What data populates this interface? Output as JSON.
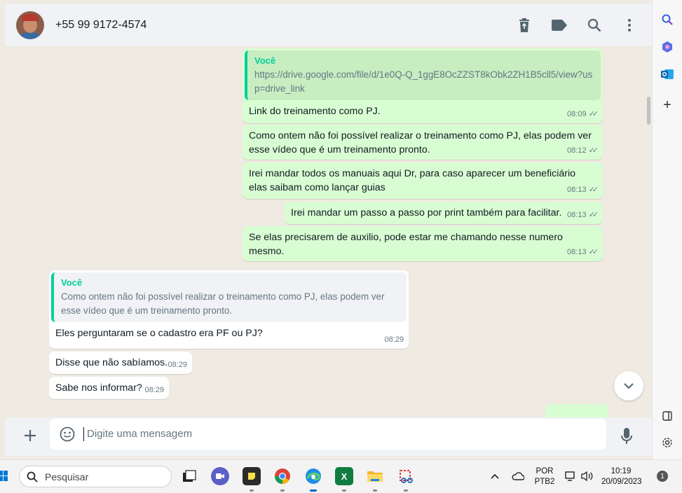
{
  "header": {
    "contact_name": "+55 99 9172-4574",
    "icons": [
      "delete-icon",
      "label-icon",
      "search-icon",
      "more-menu-icon"
    ]
  },
  "messages": [
    {
      "direction": "outgoing",
      "quote_author": "Você",
      "quote_text": "https://drive.google.com/file/d/1e0Q-Q_1ggE8OcZZST8kObk2ZH1B5cll5/view?usp=drive_link",
      "text": "Link do treinamento como PJ.",
      "time": "08:09",
      "status": "read"
    },
    {
      "direction": "outgoing",
      "text": "Como ontem não foi possível realizar o treinamento como PJ, elas podem ver esse vídeo que é um treinamento pronto.",
      "time": "08:12",
      "status": "read"
    },
    {
      "direction": "outgoing",
      "text": "Irei mandar todos os manuais aqui Dr, para caso aparecer um beneficiário elas saibam como lançar guias",
      "time": "08:13",
      "status": "read"
    },
    {
      "direction": "outgoing",
      "text": "Irei mandar um passo a passo por print também para facilitar.",
      "time": "08:13",
      "status": "read"
    },
    {
      "direction": "outgoing",
      "text": "Se elas precisarem de auxilio, pode estar me chamando nesse numero mesmo.",
      "time": "08:13",
      "status": "read"
    },
    {
      "direction": "incoming",
      "quote_author": "Você",
      "quote_text": "Como ontem não foi possível realizar o treinamento como PJ, elas podem ver esse vídeo que é um treinamento pronto.",
      "text": "Eles perguntaram se o cadastro era PF ou PJ?",
      "time": "08:29"
    },
    {
      "direction": "incoming",
      "text": "Disse que não sabíamos.",
      "time": "08:29"
    },
    {
      "direction": "incoming",
      "text": "Sabe nos informar?",
      "time": "08:29"
    }
  ],
  "composer": {
    "placeholder": "Digite uma mensagem"
  },
  "taskbar": {
    "search_label": "Pesquisar",
    "apps": [
      "task-view",
      "teams",
      "sticky-notes",
      "chrome",
      "edge",
      "excel",
      "file-explorer",
      "snipping-tool"
    ],
    "language_line1": "POR",
    "language_line2": "PTB2",
    "time": "10:19",
    "date": "20/09/2023",
    "notification_count": "1"
  },
  "colors": {
    "outgoing_bubble": "#d9fdd3",
    "incoming_bubble": "#ffffff",
    "chat_background": "#efeae2",
    "quote_accent": "#06cf9c"
  }
}
